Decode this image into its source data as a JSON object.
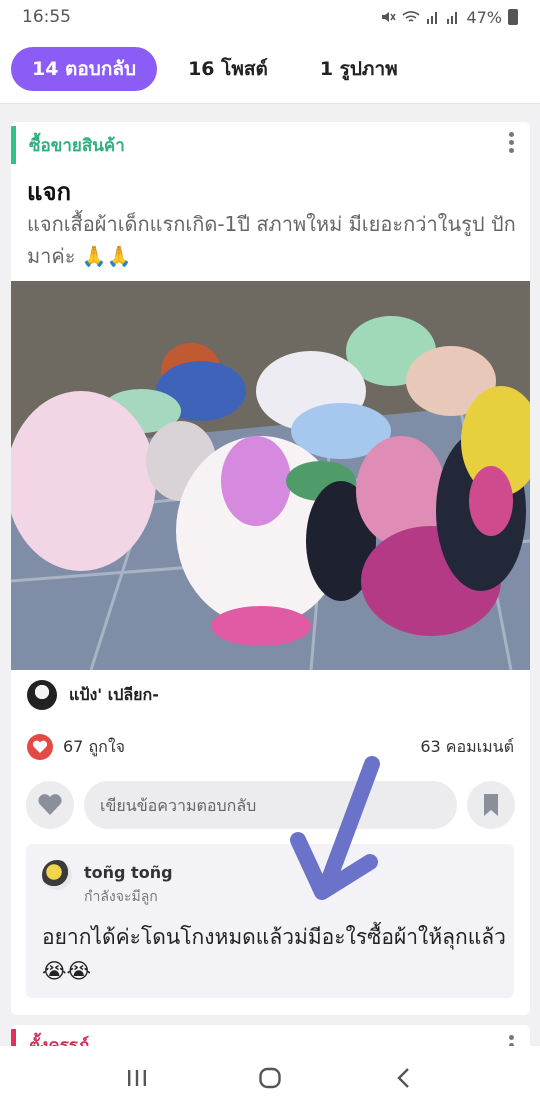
{
  "status_bar": {
    "time": "16:55",
    "battery": "47%"
  },
  "tabs": [
    {
      "label": "14 ตอบกลับ",
      "active": true
    },
    {
      "label": "16 โพสต์",
      "active": false
    },
    {
      "label": "1 รูปภาพ",
      "active": false
    }
  ],
  "post": {
    "category": "ซื้อขายสินค้า",
    "title": "แจก",
    "body": "แจกเสื้อผ้าเด็กแรกเกิด-1ปี สภาพใหม่ มีเยอะกว่าในรูป ปักมาค่ะ 🙏🙏",
    "author": "แป้ง' เปลียก-",
    "likes": "67 ถูกใจ",
    "comments": "63 คอมเมนต์",
    "reply_placeholder": "เขียนข้อความตอบกลับ"
  },
  "comment": {
    "name": "toñg toñg",
    "status": "กำลังจะมีลูก",
    "text": "อยากได้ค่ะโดนโกงหมดแล้วม่มีอะใรซื้อผ้าให้ลุกแล้ว😭😭"
  },
  "next_post": {
    "category": "ตั้งครรภ์"
  },
  "colors": {
    "accent": "#8b5cf6",
    "category_green": "#2fb07e",
    "like_red": "#e44a45",
    "annotation": "#6a73c9"
  }
}
